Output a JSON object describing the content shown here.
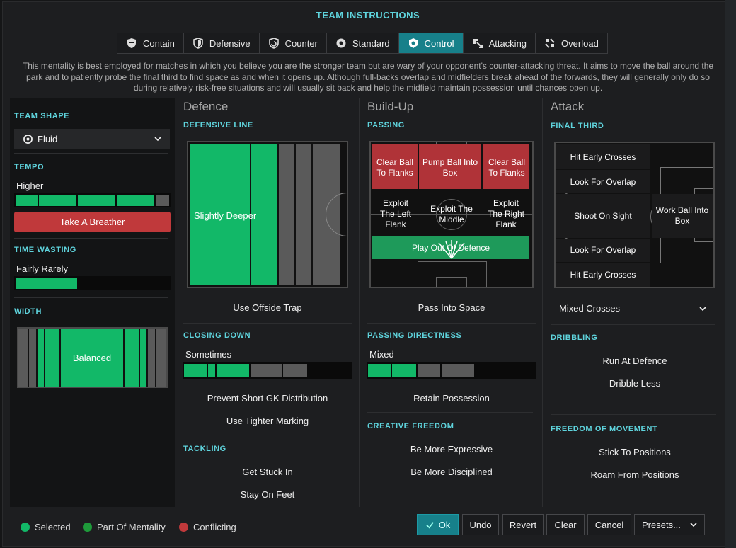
{
  "title": "TEAM INSTRUCTIONS",
  "tabs": [
    {
      "label": "Contain",
      "icon": "contain-icon"
    },
    {
      "label": "Defensive",
      "icon": "shield-icon"
    },
    {
      "label": "Counter",
      "icon": "counter-icon"
    },
    {
      "label": "Standard",
      "icon": "standard-icon"
    },
    {
      "label": "Control",
      "icon": "control-icon"
    },
    {
      "label": "Attacking",
      "icon": "attacking-icon"
    },
    {
      "label": "Overload",
      "icon": "overload-icon"
    }
  ],
  "active_tab": "Control",
  "description": "This mentality is best employed for matches in which you believe you are the stronger team but are wary of your opponent's counter-attacking threat. It aims to move the ball around the park and to patiently probe the final third to find space as and when it opens up. Although full-backs overlap and midfielders break ahead of the forwards, they will generally only do so during relatively risk-free situations and will usually sit back and help the midfield maintain possession until chances open up.",
  "left": {
    "team_shape": {
      "heading": "TEAM SHAPE",
      "value": "Fluid"
    },
    "tempo": {
      "heading": "TEMPO",
      "value": "Higher",
      "level": 4,
      "max": 5,
      "button": "Take A Breather"
    },
    "time_wasting": {
      "heading": "TIME WASTING",
      "value": "Fairly Rarely",
      "fill": 0.4
    },
    "width": {
      "heading": "WIDTH",
      "value": "Balanced"
    }
  },
  "defence": {
    "title": "Defence",
    "defensive_line": {
      "heading": "DEFENSIVE LINE",
      "value": "Slightly Deeper"
    },
    "offside": "Use Offside Trap",
    "closing_down": {
      "heading": "CLOSING DOWN",
      "value": "Sometimes",
      "level": 3,
      "max": 5
    },
    "options1": [
      "Prevent Short GK Distribution",
      "Use Tighter Marking"
    ],
    "tackling": {
      "heading": "TACKLING",
      "options": [
        "Get Stuck In",
        "Stay On Feet"
      ]
    }
  },
  "buildup": {
    "title": "Build-Up",
    "passing": {
      "heading": "PASSING",
      "top": [
        "Clear Ball To Flanks",
        "Pump Ball Into Box",
        "Clear Ball To Flanks"
      ],
      "mid": [
        "Exploit The Left Flank",
        "Exploit The Middle",
        "Exploit The Right Flank"
      ],
      "bottom": "Play Out Of Defence"
    },
    "pass_into_space": "Pass Into Space",
    "directness": {
      "heading": "PASSING DIRECTNESS",
      "value": "Mixed",
      "level": 2,
      "max": 4
    },
    "retain": "Retain Possession",
    "creative": {
      "heading": "CREATIVE FREEDOM",
      "options": [
        "Be More Expressive",
        "Be More Disciplined"
      ]
    }
  },
  "attack": {
    "title": "Attack",
    "final_third": {
      "heading": "FINAL THIRD",
      "rows": [
        "Hit Early Crosses",
        "Look For Overlap",
        "Shoot On Sight",
        "Look For Overlap",
        "Hit Early Crosses"
      ],
      "box": "Work Ball Into Box"
    },
    "crosses": "Mixed Crosses",
    "dribbling": {
      "heading": "DRIBBLING",
      "options": [
        "Run At Defence",
        "Dribble Less"
      ]
    },
    "freedom": {
      "heading": "FREEDOM OF MOVEMENT",
      "options": [
        "Stick To Positions",
        "Roam From Positions"
      ]
    }
  },
  "legend": [
    {
      "label": "Selected",
      "color": "#12b868"
    },
    {
      "label": "Part Of Mentality",
      "color": "#1e9a3a"
    },
    {
      "label": "Conflicting",
      "color": "#c0393b"
    }
  ],
  "buttons": {
    "ok": "Ok",
    "undo": "Undo",
    "revert": "Revert",
    "clear": "Clear",
    "cancel": "Cancel",
    "presets": "Presets..."
  },
  "colors": {
    "accent": "#5fd4dd",
    "selected": "#12b868",
    "conflict": "#c0393b",
    "tab_active": "#17808a"
  }
}
